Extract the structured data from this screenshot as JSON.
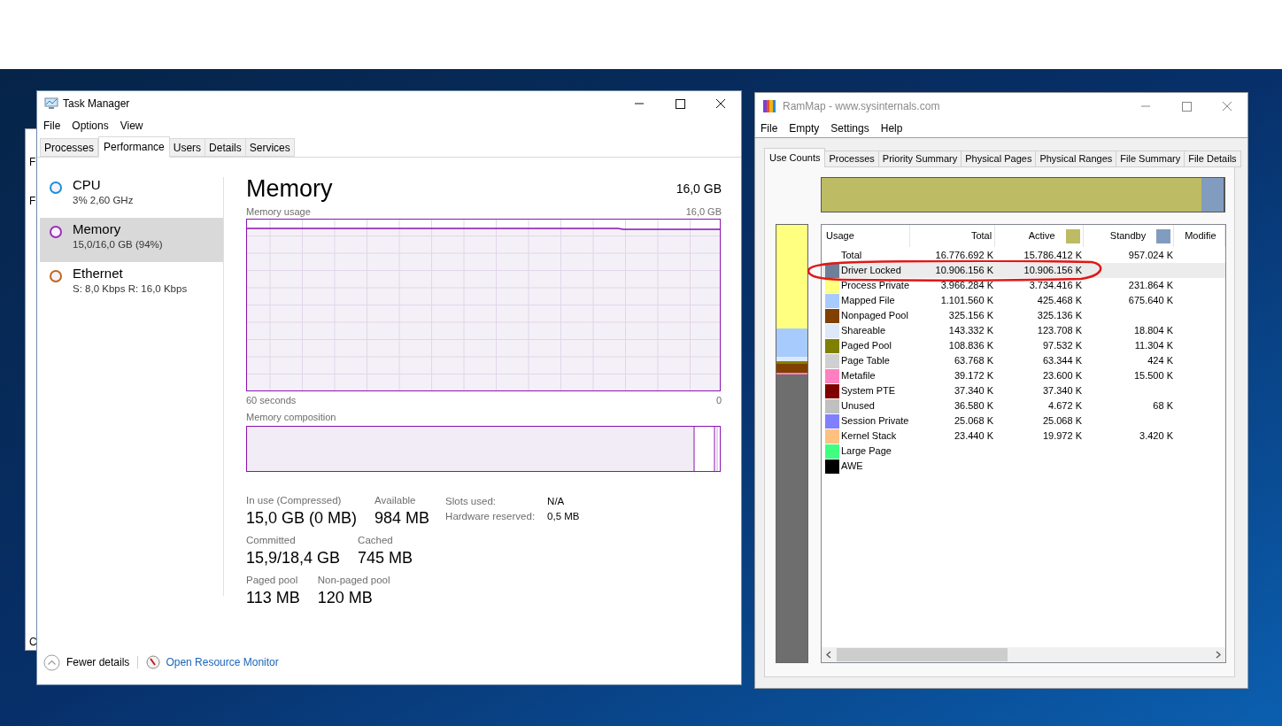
{
  "background_window": {
    "fragments": [
      "F",
      "F",
      "C"
    ]
  },
  "task_manager": {
    "title": "Task Manager",
    "menu": [
      "File",
      "Options",
      "View"
    ],
    "tabs": [
      {
        "label": "Processes",
        "selected": false
      },
      {
        "label": "Performance",
        "selected": true
      },
      {
        "label": "Users",
        "selected": false
      },
      {
        "label": "Details",
        "selected": false
      },
      {
        "label": "Services",
        "selected": false
      }
    ],
    "sidebar": [
      {
        "name": "CPU",
        "detail": "3% 2,60 GHz",
        "color": "#1d8fd6",
        "selected": false
      },
      {
        "name": "Memory",
        "detail": "15,0/16,0 GB (94%)",
        "color": "#9b2fb8",
        "selected": true
      },
      {
        "name": "Ethernet",
        "detail": "S: 8,0 Kbps R: 16,0 Kbps",
        "color": "#c0661b",
        "selected": false
      }
    ],
    "heading": "Memory",
    "capacity": "16,0 GB",
    "usage_graph": {
      "label": "Memory usage",
      "max": "16,0 GB",
      "x_start": "60 seconds",
      "x_end": "0"
    },
    "composition": {
      "label": "Memory composition"
    },
    "stats": [
      [
        {
          "label": "In use (Compressed)",
          "value": "15,0 GB (0 MB)"
        },
        {
          "label": "Available",
          "value": "984 MB"
        }
      ],
      [
        {
          "label": "Committed",
          "value": "15,9/18,4 GB"
        },
        {
          "label": "Cached",
          "value": "745 MB"
        }
      ],
      [
        {
          "label": "Paged pool",
          "value": "113 MB"
        },
        {
          "label": "Non-paged pool",
          "value": "120 MB"
        }
      ]
    ],
    "details": [
      {
        "label": "Slots used:",
        "value": "N/A"
      },
      {
        "label": "Hardware reserved:",
        "value": "0,5 MB"
      }
    ],
    "footer": {
      "fewer_details": "Fewer details",
      "link": "Open Resource Monitor"
    }
  },
  "rammap": {
    "title": "RamMap - www.sysinternals.com",
    "menu": [
      "File",
      "Empty",
      "Settings",
      "Help"
    ],
    "tabs": [
      {
        "label": "Use Counts",
        "selected": true
      },
      {
        "label": "Processes",
        "selected": false
      },
      {
        "label": "Priority Summary",
        "selected": false
      },
      {
        "label": "Physical Pages",
        "selected": false
      },
      {
        "label": "Physical Ranges",
        "selected": false
      },
      {
        "label": "File Summary",
        "selected": false
      },
      {
        "label": "File Details",
        "selected": false
      }
    ],
    "columns": [
      {
        "label": "Usage"
      },
      {
        "label": "Total"
      },
      {
        "label": "Active",
        "color": "#bdbb63"
      },
      {
        "label": "Standby",
        "color": "#819cbf"
      },
      {
        "label": "Modifie"
      }
    ],
    "rows": [
      {
        "usage": "Total",
        "total": "16.776.692 K",
        "active": "15.786.412 K",
        "standby": "957.024 K",
        "selected": false
      },
      {
        "usage": "Driver Locked",
        "color": "#6e7f99",
        "total": "10.906.156 K",
        "active": "10.906.156 K",
        "selected": true
      },
      {
        "usage": "Process Private",
        "color": "#ffff80",
        "total": "3.966.284 K",
        "active": "3.734.416 K",
        "standby": "231.864 K",
        "selected": false
      },
      {
        "usage": "Mapped File",
        "color": "#a8cbfd",
        "total": "1.101.560 K",
        "active": "425.468 K",
        "standby": "675.640 K",
        "selected": false
      },
      {
        "usage": "Nonpaged Pool",
        "color": "#804000",
        "total": "325.156 K",
        "active": "325.136 K",
        "selected": false
      },
      {
        "usage": "Shareable",
        "color": "#dde8f8",
        "total": "143.332 K",
        "active": "123.708 K",
        "standby": "18.804 K",
        "selected": false
      },
      {
        "usage": "Paged Pool",
        "color": "#808000",
        "total": "108.836 K",
        "active": "97.532 K",
        "standby": "11.304 K",
        "selected": false
      },
      {
        "usage": "Page Table",
        "color": "#d0d0d0",
        "total": "63.768 K",
        "active": "63.344 K",
        "standby": "424 K",
        "selected": false
      },
      {
        "usage": "Metafile",
        "color": "#ff80c0",
        "total": "39.172 K",
        "active": "23.600 K",
        "standby": "15.500 K",
        "selected": false
      },
      {
        "usage": "System PTE",
        "color": "#800000",
        "total": "37.340 K",
        "active": "37.340 K",
        "selected": false
      },
      {
        "usage": "Unused",
        "color": "#c0c0c0",
        "total": "36.580 K",
        "active": "4.672 K",
        "standby": "68 K",
        "selected": false
      },
      {
        "usage": "Session Private",
        "color": "#8080ff",
        "total": "25.068 K",
        "active": "25.068 K",
        "selected": false
      },
      {
        "usage": "Kernel Stack",
        "color": "#ffc080",
        "total": "23.440 K",
        "active": "19.972 K",
        "standby": "3.420 K",
        "selected": false
      },
      {
        "usage": "Large Page",
        "color": "#40ff80",
        "selected": false
      },
      {
        "usage": "AWE",
        "color": "#000000",
        "selected": false
      }
    ],
    "annotation": {
      "kind": "ellipse",
      "color": "#e01818"
    }
  }
}
